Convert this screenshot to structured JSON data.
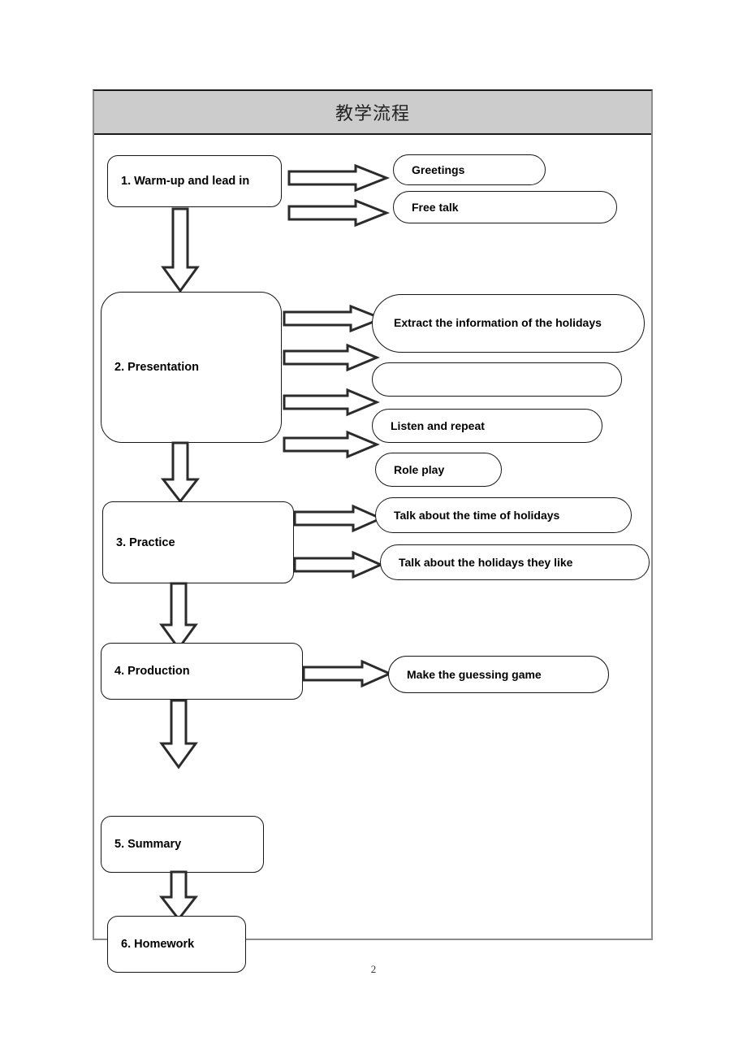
{
  "document": {
    "page_number": "2",
    "table_title": "教学流程"
  },
  "flow": {
    "stages": [
      {
        "id": "warm-up",
        "label": "1. Warm-up and lead in"
      },
      {
        "id": "presentation",
        "label": "2. Presentation"
      },
      {
        "id": "practice",
        "label": "3. Practice"
      },
      {
        "id": "production",
        "label": "4. Production"
      },
      {
        "id": "summary",
        "label": "5. Summary"
      },
      {
        "id": "homework",
        "label": "6. Homework"
      }
    ],
    "activities": [
      {
        "id": "greetings",
        "label": "Greetings",
        "stage": "warm-up"
      },
      {
        "id": "free-talk",
        "label": "Free talk",
        "stage": "warm-up"
      },
      {
        "id": "extract-info",
        "label": "Extract the information of the holidays",
        "stage": "presentation"
      },
      {
        "id": "blank",
        "label": "",
        "stage": "presentation"
      },
      {
        "id": "listen-repeat",
        "label": "Listen and repeat",
        "stage": "presentation"
      },
      {
        "id": "role-play",
        "label": "Role play",
        "stage": "presentation"
      },
      {
        "id": "talk-time",
        "label": "Talk about the time of holidays",
        "stage": "practice"
      },
      {
        "id": "talk-like",
        "label": "Talk about the holidays they like",
        "stage": "practice"
      },
      {
        "id": "guessing-game",
        "label": "Make the guessing game",
        "stage": "production"
      }
    ]
  },
  "colors": {
    "title_bar_fill": "#cccccc",
    "outline": "#161616",
    "frame_border": "#8c8c8c",
    "page_background": "#ffffff"
  }
}
